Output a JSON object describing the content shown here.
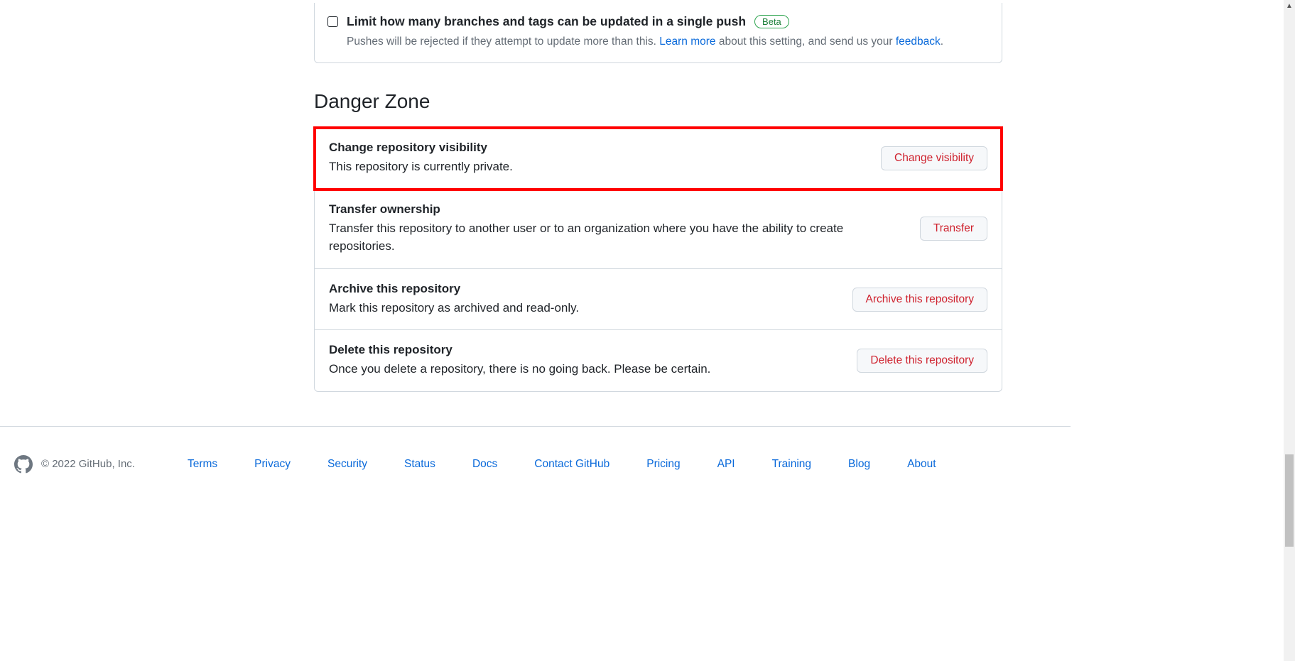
{
  "push_rules": {
    "title": "Limit how many branches and tags can be updated in a single push",
    "badge": "Beta",
    "desc_prefix": "Pushes will be rejected if they attempt to update more than this. ",
    "learn_more": "Learn more",
    "desc_mid": " about this setting, and send us your ",
    "feedback": "feedback",
    "desc_suffix": "."
  },
  "danger_zone": {
    "heading": "Danger Zone",
    "rows": [
      {
        "title": "Change repository visibility",
        "desc": "This repository is currently private.",
        "button": "Change visibility",
        "highlight": true
      },
      {
        "title": "Transfer ownership",
        "desc": "Transfer this repository to another user or to an organization where you have the ability to create repositories.",
        "button": "Transfer",
        "highlight": false
      },
      {
        "title": "Archive this repository",
        "desc": "Mark this repository as archived and read-only.",
        "button": "Archive this repository",
        "highlight": false
      },
      {
        "title": "Delete this repository",
        "desc": "Once you delete a repository, there is no going back. Please be certain.",
        "button": "Delete this repository",
        "highlight": false
      }
    ]
  },
  "footer": {
    "copyright": "© 2022 GitHub, Inc.",
    "links": [
      "Terms",
      "Privacy",
      "Security",
      "Status",
      "Docs",
      "Contact GitHub",
      "Pricing",
      "API",
      "Training",
      "Blog",
      "About"
    ]
  }
}
